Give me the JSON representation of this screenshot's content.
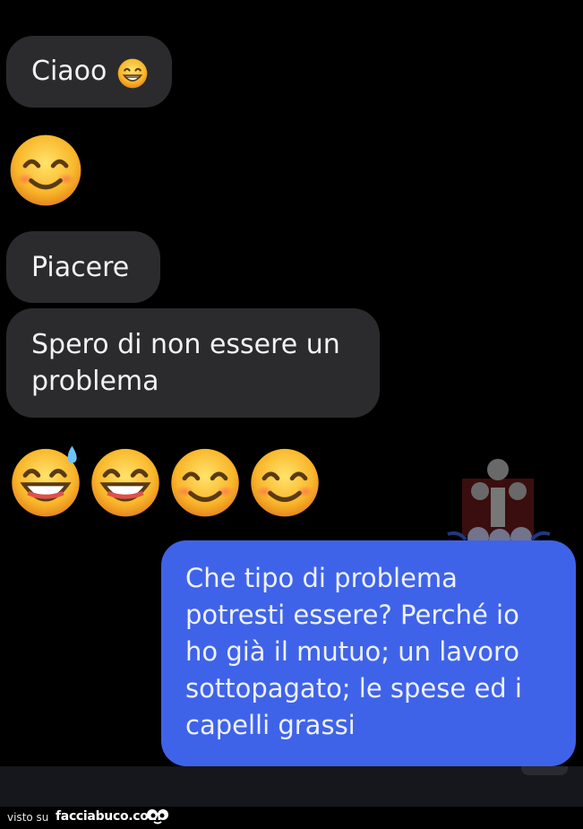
{
  "messages": {
    "m1_text": "Ciaoo",
    "m1_emoji": "beaming-face-emoji",
    "m2_emoji": "smiling-face-emoji",
    "m3_text": "Piacere",
    "m4_line1": "Spero di non essere un",
    "m4_line2": "problema",
    "m5_emojis": [
      "grinning-sweat-emoji",
      "grinning-face-emoji",
      "smiling-face-emoji",
      "smiling-face-emoji"
    ],
    "reply_lines": [
      "Che tipo di problema",
      "potresti essere? Perché io",
      "ho già il mutuo; un lavoro",
      "sottopagato; le spese ed i",
      "capelli grassi"
    ]
  },
  "footer": {
    "prefix": "visto su",
    "site": "facciabuco.com",
    "logo_icon": "facciabuco-eyes-icon"
  },
  "colors": {
    "background": "#000000",
    "incoming_bubble": "#2b2b2d",
    "outgoing_bubble": "#3f63e8",
    "emoji_yellow": "#f7b52b"
  }
}
